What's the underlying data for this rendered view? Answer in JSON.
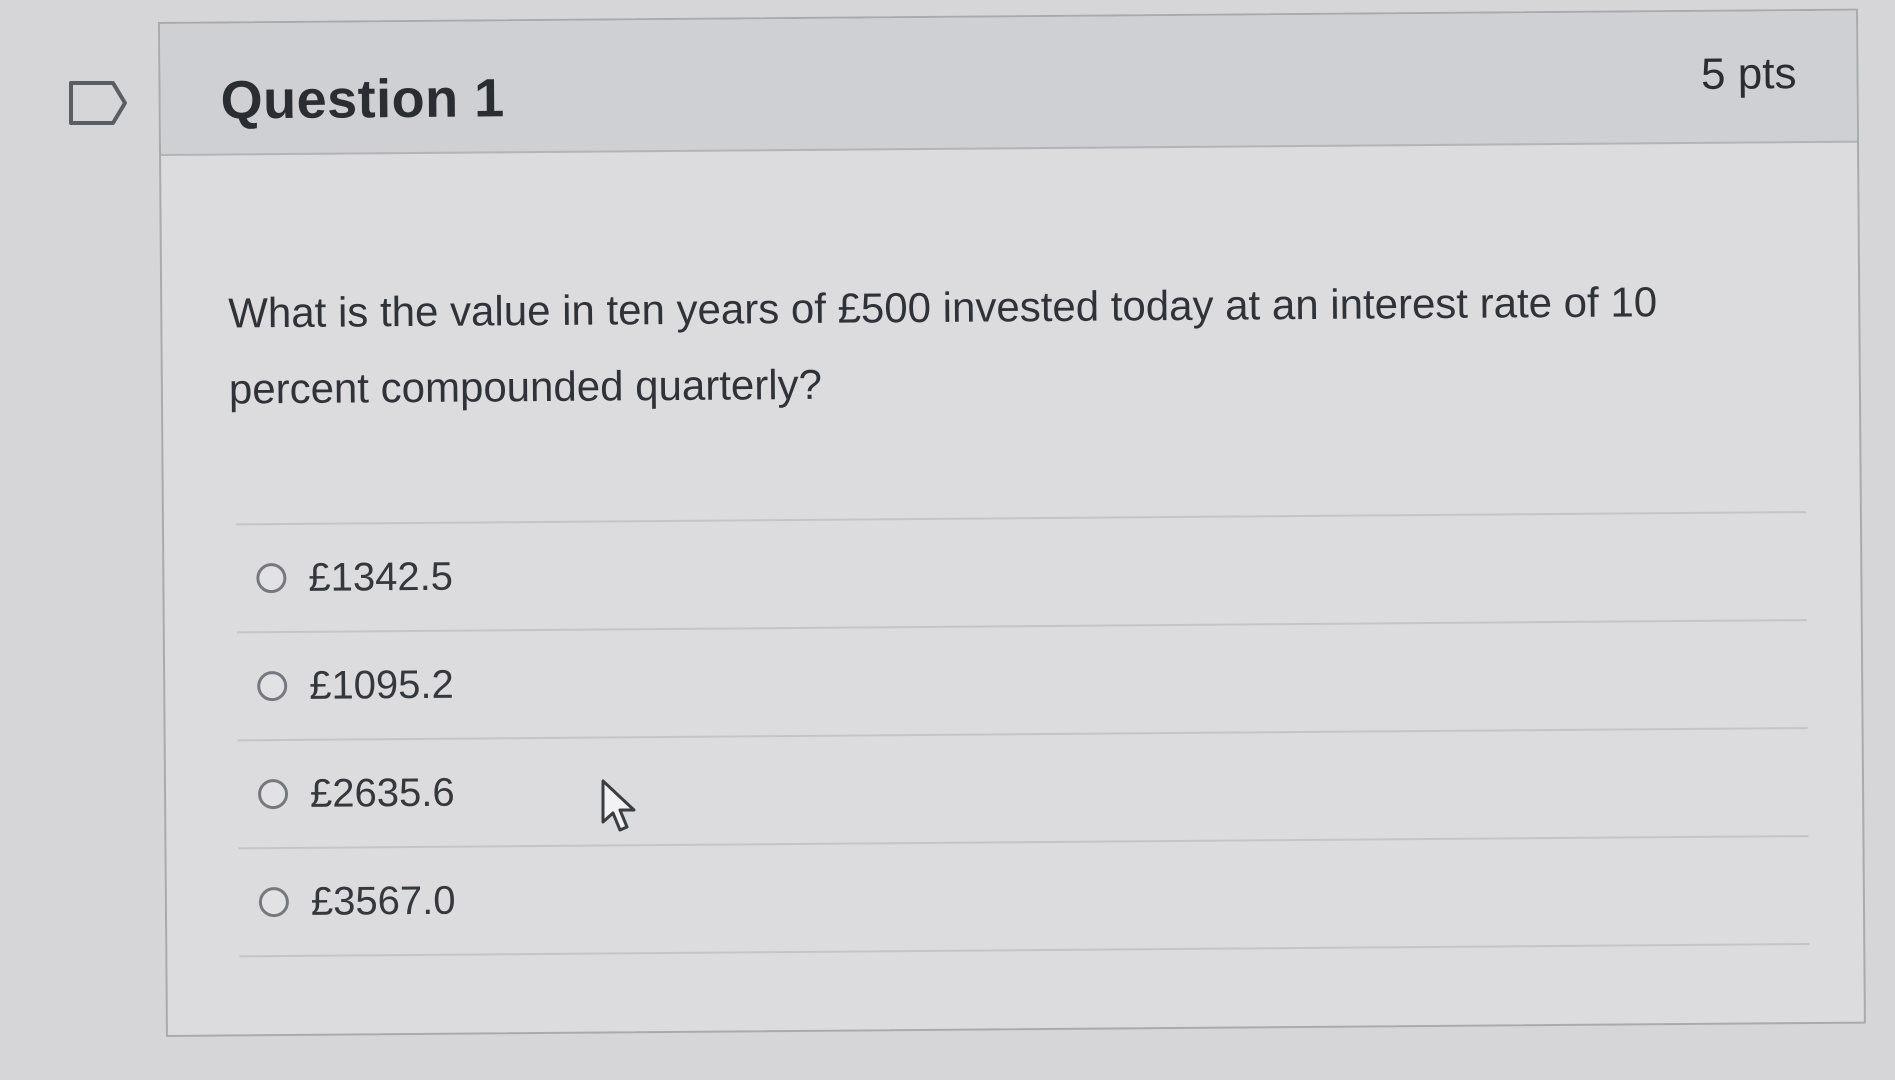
{
  "question": {
    "title": "Question 1",
    "points": "5 pts",
    "text": "What is the value in ten years of £500 invested today at an interest rate of 10 percent compounded quarterly?"
  },
  "answers": [
    {
      "label": "£1342.5",
      "selected": false
    },
    {
      "label": "£1095.2",
      "selected": false
    },
    {
      "label": "£2635.6",
      "selected": false
    },
    {
      "label": "£3567.0",
      "selected": false
    }
  ],
  "icons": {
    "flag": "flag-question-icon",
    "cursor": "mouse-pointer-icon"
  },
  "colors": {
    "background": "#d6d6d8",
    "header_background": "#cfd0d3",
    "text": "#2d3b45"
  }
}
